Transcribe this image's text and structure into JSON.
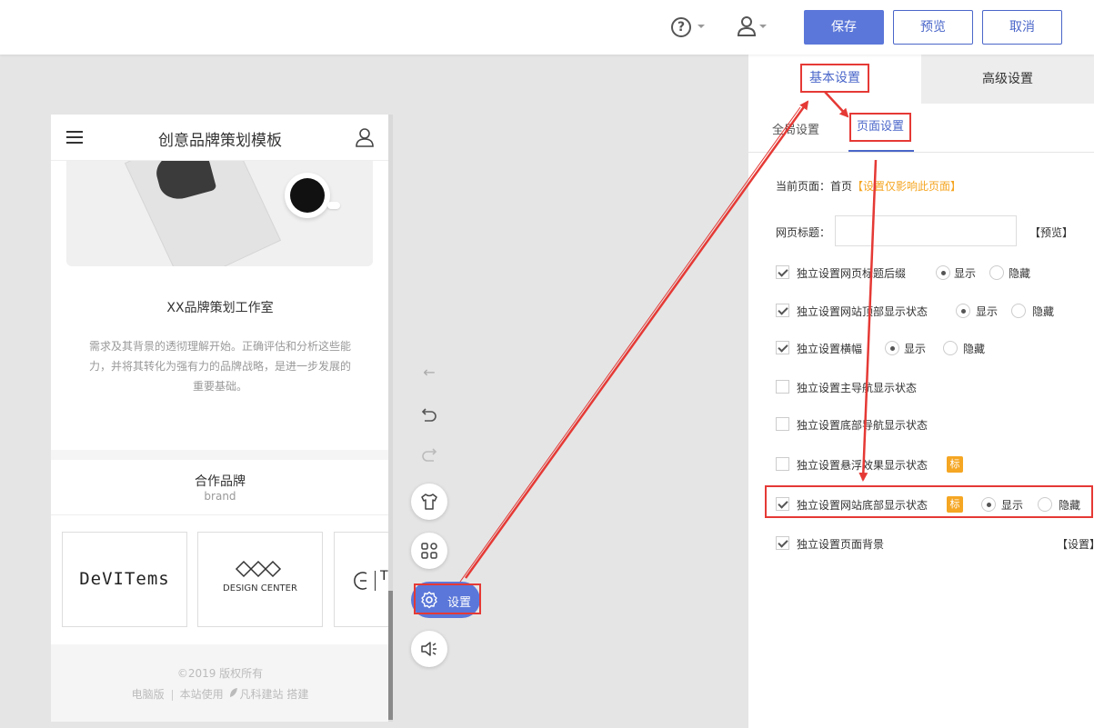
{
  "topbar": {
    "help_icon": "question-circle-icon",
    "user_icon": "user-icon",
    "save_label": "保存",
    "preview_label": "预览",
    "cancel_label": "取消",
    "accent_color": "#5b77d9"
  },
  "phone": {
    "title": "创意品牌策划模板",
    "studio_title": "XX品牌策划工作室",
    "studio_desc": "需求及其背景的透彻理解开始。正确评估和分析这些能力，并将其转化为强有力的品牌战略，是进一步发展的重要基础。",
    "partners_title": "合作品牌",
    "partners_sub": "brand",
    "brands": [
      "DeVITems",
      "DESIGN CENTER",
      "T"
    ],
    "footer_copy": "©2019 版权所有",
    "footer_links": [
      "电脑版",
      "本站使用",
      "凡科建站 搭建"
    ]
  },
  "tools": {
    "settings_label": "设置"
  },
  "panel": {
    "tab_basic": "基本设置",
    "tab_advanced": "高级设置",
    "subtab_global": "全局设置",
    "subtab_page": "页面设置",
    "current_page_label": "当前页面：首页",
    "current_page_note": "【设置仅影响此页面】",
    "title_label": "网页标题：",
    "title_value": "",
    "title_preview": "【预览】",
    "options": [
      {
        "label": "独立设置网页标题后缀",
        "checked": true,
        "radio": "显示"
      },
      {
        "label": "独立设置网站顶部显示状态",
        "checked": true,
        "radio": "显示"
      },
      {
        "label": "独立设置横幅",
        "checked": true,
        "radio": "显示"
      },
      {
        "label": "独立设置主导航显示状态",
        "checked": false
      },
      {
        "label": "独立设置底部导航显示状态",
        "checked": false
      },
      {
        "label": "独立设置悬浮效果显示状态",
        "checked": false,
        "badge": "标"
      },
      {
        "label": "独立设置网站底部显示状态",
        "checked": true,
        "badge": "标",
        "radio": "显示"
      },
      {
        "label": "独立设置页面背景",
        "checked": true,
        "action": "【设置】"
      }
    ],
    "show_label": "显示",
    "hide_label": "隐藏"
  }
}
